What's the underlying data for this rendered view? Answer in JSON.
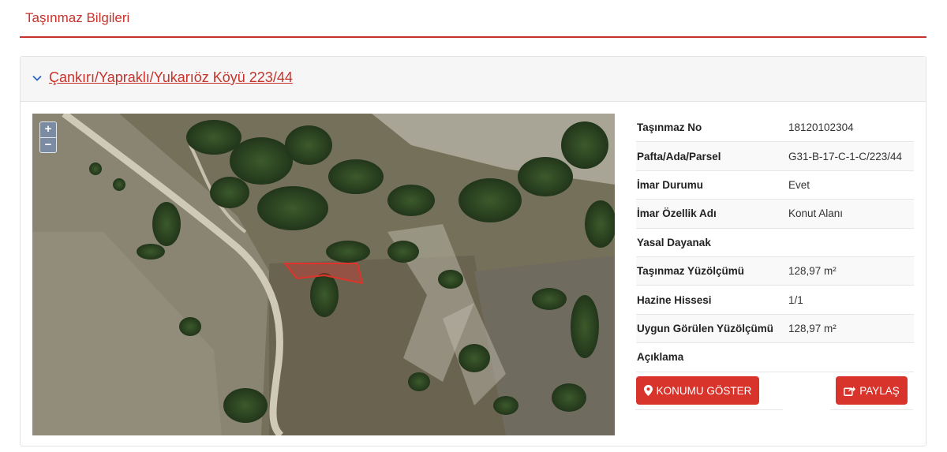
{
  "section": {
    "title": "Taşınmaz Bilgileri"
  },
  "card": {
    "header_link": "Çankırı/Yapraklı/Yukarıöz Köyü 223/44",
    "expand_icon": "chevron-down-icon"
  },
  "map": {
    "zoom_in": "+",
    "zoom_out": "−",
    "parcel_color": "#e0332b"
  },
  "info": {
    "rows": [
      {
        "label": "Taşınmaz No",
        "value": "18120102304"
      },
      {
        "label": "Pafta/Ada/Parsel",
        "value": "G31-B-17-C-1-C/223/44"
      },
      {
        "label": "İmar Durumu",
        "value": "Evet"
      },
      {
        "label": "İmar Özellik Adı",
        "value": "Konut Alanı"
      },
      {
        "label": "Yasal Dayanak",
        "value": ""
      },
      {
        "label": "Taşınmaz Yüzölçümü",
        "value": "128,97 m²"
      },
      {
        "label": "Hazine Hissesi",
        "value": "1/1"
      },
      {
        "label": "Uygun Görülen Yüzölçümü",
        "value": "128,97 m²"
      },
      {
        "label": "Açıklama",
        "value": ""
      }
    ]
  },
  "buttons": {
    "location_label": "KONUMU GÖSTER",
    "location_icon": "map-marker-icon",
    "share_label": "PAYLAŞ",
    "share_icon": "share-icon"
  },
  "colors": {
    "accent": "#c8322b",
    "button": "#d9342b"
  }
}
